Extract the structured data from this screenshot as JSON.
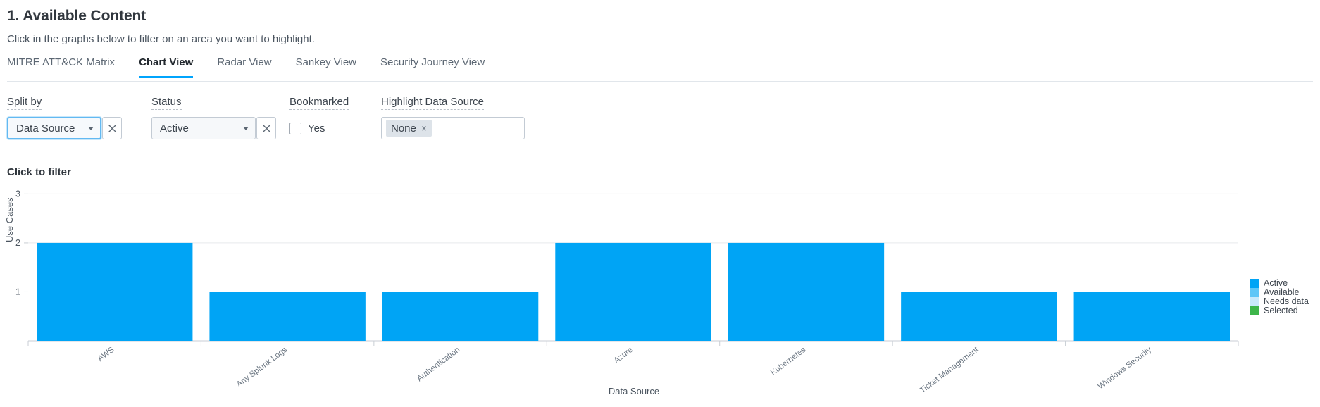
{
  "header": {
    "title": "1. Available Content",
    "subtitle": "Click in the graphs below to filter on an area you want to highlight."
  },
  "tabs": [
    {
      "label": "MITRE ATT&CK Matrix",
      "active": false
    },
    {
      "label": "Chart View",
      "active": true
    },
    {
      "label": "Radar View",
      "active": false
    },
    {
      "label": "Sankey View",
      "active": false
    },
    {
      "label": "Security Journey View",
      "active": false
    }
  ],
  "filters": {
    "split_by": {
      "label": "Split by",
      "value": "Data Source",
      "clear": "clear-icon"
    },
    "status": {
      "label": "Status",
      "value": "Active",
      "clear": "clear-icon"
    },
    "bookmarked": {
      "label": "Bookmarked",
      "option": "Yes",
      "checked": false
    },
    "highlight": {
      "label": "Highlight Data Source",
      "token": "None",
      "token_remove": "×"
    }
  },
  "chart_heading": "Click to filter",
  "chart_data": {
    "type": "bar",
    "title": "Click to filter",
    "xlabel": "Data Source",
    "ylabel": "Use Cases",
    "ylim": [
      0,
      3.25
    ],
    "yticks": [
      1,
      2,
      3
    ],
    "grid": true,
    "legend_position": "right",
    "categories": [
      "AWS",
      "Any Splunk Logs",
      "Authentication",
      "Azure",
      "Kubernetes",
      "Ticket Management",
      "Windows Security"
    ],
    "values": [
      2,
      1,
      1,
      2,
      2,
      1,
      1
    ],
    "series": [
      {
        "name": "Active",
        "values": [
          2,
          1,
          1,
          2,
          2,
          1,
          1
        ],
        "color": "#00a4f5"
      }
    ],
    "legend": [
      {
        "label": "Active",
        "color": "#00a4f5"
      },
      {
        "label": "Available",
        "color": "#5ec6f7"
      },
      {
        "label": "Needs data",
        "color": "#c8e9fb"
      },
      {
        "label": "Selected",
        "color": "#3db54a"
      }
    ]
  }
}
